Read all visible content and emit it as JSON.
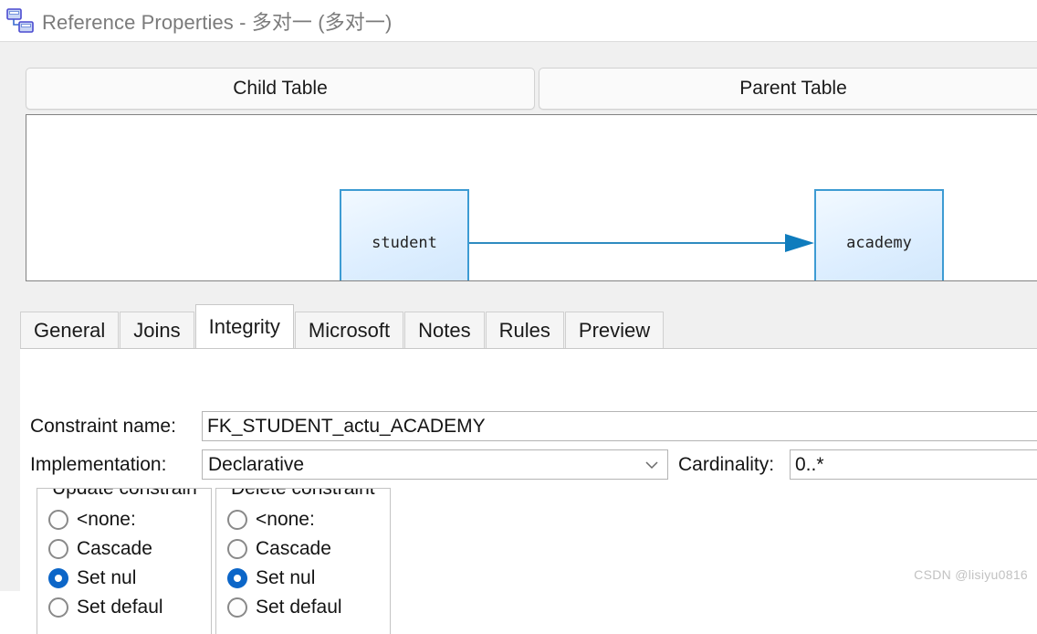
{
  "window": {
    "title": "Reference Properties - 多对一 (多对一)",
    "icon": "reference-relationship-icon"
  },
  "headers": {
    "child_table_label": "Child Table",
    "parent_table_label": "Parent Table"
  },
  "diagram": {
    "child_node": "student",
    "parent_node": "academy",
    "connector": "arrow-right",
    "node_border_color": "#3d9bd3",
    "connector_color": "#0f7cbd"
  },
  "tabs": [
    {
      "label": "General",
      "active": false
    },
    {
      "label": "Joins",
      "active": false
    },
    {
      "label": "Integrity",
      "active": true
    },
    {
      "label": "Microsoft",
      "active": false
    },
    {
      "label": "Notes",
      "active": false
    },
    {
      "label": "Rules",
      "active": false
    },
    {
      "label": "Preview",
      "active": false
    }
  ],
  "integrity": {
    "constraint_name_label": "Constraint name:",
    "constraint_name_value": "FK_STUDENT_actu_ACADEMY",
    "implementation_label": "Implementation:",
    "implementation_value": "Declarative",
    "implementation_arrow": "chevron-down-icon",
    "cardinality_label": "Cardinality:",
    "cardinality_value": "0..*",
    "update_group": {
      "title": "Update constrain",
      "options": [
        {
          "label": "<none:",
          "selected": false
        },
        {
          "label": "Cascade",
          "selected": false
        },
        {
          "label": "Set nul",
          "selected": true
        },
        {
          "label": "Set defaul",
          "selected": false
        }
      ]
    },
    "delete_group": {
      "title": "Delete constraint",
      "options": [
        {
          "label": "<none:",
          "selected": false
        },
        {
          "label": "Cascade",
          "selected": false
        },
        {
          "label": "Set nul",
          "selected": true
        },
        {
          "label": "Set defaul",
          "selected": false
        }
      ]
    }
  },
  "watermark": "CSDN @lisiyu0816",
  "accent_color": "#0c66c8"
}
